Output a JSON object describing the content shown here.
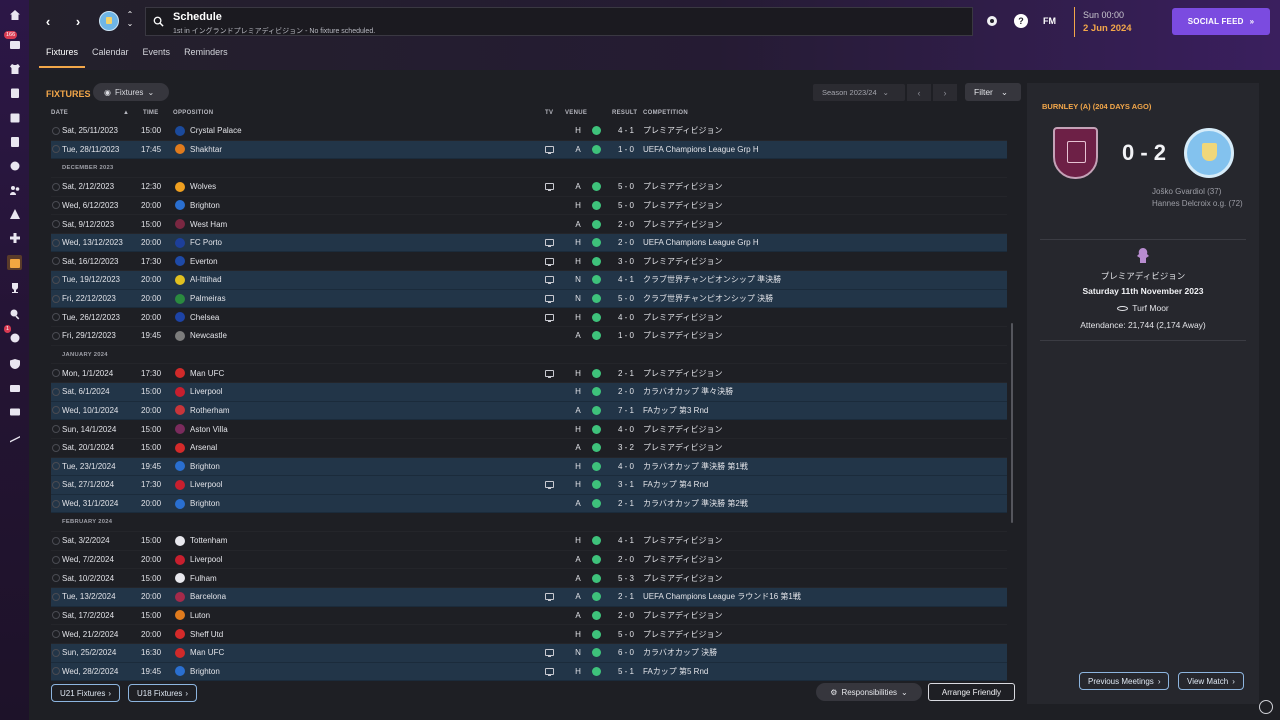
{
  "header": {
    "title": "Schedule",
    "subtitle": "1st in イングランドプレミアディビジョン - No fixture scheduled.",
    "back_glyph": "‹",
    "forward_glyph": "›",
    "fm_logo": "FM",
    "help_glyph": "?",
    "date_time": "Sun 00:00",
    "date_day": "2 Jun 2024",
    "social_feed": "SOCIAL FEED"
  },
  "tabs": [
    "Fixtures",
    "Calendar",
    "Events",
    "Reminders"
  ],
  "rail": {
    "badges": [
      "166",
      "1"
    ]
  },
  "main": {
    "section_label": "FIXTURES",
    "view_dropdown": "Fixtures",
    "season": "Season 2023/24",
    "filter": "Filter",
    "columns": {
      "date": "DATE",
      "time": "TIME",
      "opposition": "OPPOSITION",
      "tv": "TV",
      "venue": "VENUE",
      "result": "RESULT",
      "competition": "COMPETITION"
    },
    "rows": [
      {
        "date": "Sat, 25/11/2023",
        "time": "15:00",
        "opp": "Crystal Palace",
        "crest": "#1b4a9c",
        "tv": false,
        "venue": "H",
        "result": "4 - 1",
        "comp": "プレミアディビジョン",
        "hl": false
      },
      {
        "date": "Tue, 28/11/2023",
        "time": "17:45",
        "opp": "Shakhtar",
        "crest": "#e07b1d",
        "tv": true,
        "venue": "A",
        "result": "1 - 0",
        "comp": "UEFA Champions League Grp H",
        "hl": true
      },
      {
        "month": "DECEMBER 2023"
      },
      {
        "date": "Sat, 2/12/2023",
        "time": "12:30",
        "opp": "Wolves",
        "crest": "#f0a020",
        "tv": true,
        "venue": "A",
        "result": "5 - 0",
        "comp": "プレミアディビジョン",
        "hl": false
      },
      {
        "date": "Wed, 6/12/2023",
        "time": "20:00",
        "opp": "Brighton",
        "crest": "#2a6fd0",
        "tv": false,
        "venue": "H",
        "result": "5 - 0",
        "comp": "プレミアディビジョン",
        "hl": false
      },
      {
        "date": "Sat, 9/12/2023",
        "time": "15:00",
        "opp": "West Ham",
        "crest": "#7a2741",
        "tv": false,
        "venue": "A",
        "result": "2 - 0",
        "comp": "プレミアディビジョン",
        "hl": false
      },
      {
        "date": "Wed, 13/12/2023",
        "time": "20:00",
        "opp": "FC Porto",
        "crest": "#1d3f9a",
        "tv": true,
        "venue": "H",
        "result": "2 - 0",
        "comp": "UEFA Champions League Grp H",
        "hl": true
      },
      {
        "date": "Sat, 16/12/2023",
        "time": "17:30",
        "opp": "Everton",
        "crest": "#1e4aa8",
        "tv": true,
        "venue": "H",
        "result": "3 - 0",
        "comp": "プレミアディビジョン",
        "hl": false
      },
      {
        "date": "Tue, 19/12/2023",
        "time": "20:00",
        "opp": "Al-Ittihad",
        "crest": "#e0c020",
        "tv": true,
        "venue": "N",
        "result": "4 - 1",
        "comp": "クラブ世界チャンピオンシップ 準決勝",
        "hl": true
      },
      {
        "date": "Fri, 22/12/2023",
        "time": "20:00",
        "opp": "Palmeiras",
        "crest": "#2a8a3f",
        "tv": true,
        "venue": "N",
        "result": "5 - 0",
        "comp": "クラブ世界チャンピオンシップ 決勝",
        "hl": true
      },
      {
        "date": "Tue, 26/12/2023",
        "time": "20:00",
        "opp": "Chelsea",
        "crest": "#1d43a5",
        "tv": true,
        "venue": "H",
        "result": "4 - 0",
        "comp": "プレミアディビジョン",
        "hl": false
      },
      {
        "date": "Fri, 29/12/2023",
        "time": "19:45",
        "opp": "Newcastle",
        "crest": "#7c7c7c",
        "tv": false,
        "venue": "A",
        "result": "1 - 0",
        "comp": "プレミアディビジョン",
        "hl": false
      },
      {
        "month": "JANUARY 2024"
      },
      {
        "date": "Mon, 1/1/2024",
        "time": "17:30",
        "opp": "Man UFC",
        "crest": "#d02a2a",
        "tv": true,
        "venue": "H",
        "result": "2 - 1",
        "comp": "プレミアディビジョン",
        "hl": false
      },
      {
        "date": "Sat, 6/1/2024",
        "time": "15:00",
        "opp": "Liverpool",
        "crest": "#c81f2e",
        "tv": false,
        "venue": "H",
        "result": "2 - 0",
        "comp": "カラバオカップ 準々決勝",
        "hl": true
      },
      {
        "date": "Wed, 10/1/2024",
        "time": "20:00",
        "opp": "Rotherham",
        "crest": "#c8353a",
        "tv": false,
        "venue": "A",
        "result": "7 - 1",
        "comp": "FAカップ 第3 Rnd",
        "hl": true
      },
      {
        "date": "Sun, 14/1/2024",
        "time": "15:00",
        "opp": "Aston Villa",
        "crest": "#7a2b5c",
        "tv": false,
        "venue": "H",
        "result": "4 - 0",
        "comp": "プレミアディビジョン",
        "hl": false
      },
      {
        "date": "Sat, 20/1/2024",
        "time": "15:00",
        "opp": "Arsenal",
        "crest": "#d42a2a",
        "tv": false,
        "venue": "A",
        "result": "3 - 2",
        "comp": "プレミアディビジョン",
        "hl": false
      },
      {
        "date": "Tue, 23/1/2024",
        "time": "19:45",
        "opp": "Brighton",
        "crest": "#2a6fd0",
        "tv": false,
        "venue": "H",
        "result": "4 - 0",
        "comp": "カラバオカップ 準決勝 第1戦",
        "hl": true
      },
      {
        "date": "Sat, 27/1/2024",
        "time": "17:30",
        "opp": "Liverpool",
        "crest": "#c81f2e",
        "tv": true,
        "venue": "H",
        "result": "3 - 1",
        "comp": "FAカップ 第4 Rnd",
        "hl": true
      },
      {
        "date": "Wed, 31/1/2024",
        "time": "20:00",
        "opp": "Brighton",
        "crest": "#2a6fd0",
        "tv": false,
        "venue": "A",
        "result": "2 - 1",
        "comp": "カラバオカップ 準決勝 第2戦",
        "hl": true
      },
      {
        "month": "FEBRUARY 2024"
      },
      {
        "date": "Sat, 3/2/2024",
        "time": "15:00",
        "opp": "Tottenham",
        "crest": "#e8e8ee",
        "tv": false,
        "venue": "H",
        "result": "4 - 1",
        "comp": "プレミアディビジョン",
        "hl": false
      },
      {
        "date": "Wed, 7/2/2024",
        "time": "20:00",
        "opp": "Liverpool",
        "crest": "#c81f2e",
        "tv": false,
        "venue": "A",
        "result": "2 - 0",
        "comp": "プレミアディビジョン",
        "hl": false
      },
      {
        "date": "Sat, 10/2/2024",
        "time": "15:00",
        "opp": "Fulham",
        "crest": "#e8e8ee",
        "tv": false,
        "venue": "A",
        "result": "5 - 3",
        "comp": "プレミアディビジョン",
        "hl": false
      },
      {
        "date": "Tue, 13/2/2024",
        "time": "20:00",
        "opp": "Barcelona",
        "crest": "#a52a4a",
        "tv": true,
        "venue": "A",
        "result": "2 - 1",
        "comp": "UEFA Champions League ラウンド16 第1戦",
        "hl": true
      },
      {
        "date": "Sat, 17/2/2024",
        "time": "15:00",
        "opp": "Luton",
        "crest": "#e07b1d",
        "tv": false,
        "venue": "A",
        "result": "2 - 0",
        "comp": "プレミアディビジョン",
        "hl": false
      },
      {
        "date": "Wed, 21/2/2024",
        "time": "20:00",
        "opp": "Sheff Utd",
        "crest": "#d42a2a",
        "tv": false,
        "venue": "H",
        "result": "5 - 0",
        "comp": "プレミアディビジョン",
        "hl": false
      },
      {
        "date": "Sun, 25/2/2024",
        "time": "16:30",
        "opp": "Man UFC",
        "crest": "#d02a2a",
        "tv": true,
        "venue": "N",
        "result": "6 - 0",
        "comp": "カラバオカップ 決勝",
        "hl": true
      },
      {
        "date": "Wed, 28/2/2024",
        "time": "19:45",
        "opp": "Brighton",
        "crest": "#2a6fd0",
        "tv": true,
        "venue": "H",
        "result": "5 - 1",
        "comp": "FAカップ 第5 Rnd",
        "hl": true
      }
    ],
    "u21_button": "U21 Fixtures",
    "u18_button": "U18 Fixtures",
    "responsibilities": "Responsibilities",
    "arrange_friendly": "Arrange Friendly"
  },
  "side": {
    "heading": "BURNLEY (A) (204 DAYS AGO)",
    "score": "0 - 2",
    "scorer_1": "Joško Gvardiol (37)",
    "scorer_2": "Hannes Delcroix o.g. (72)",
    "competition": "プレミアディビジョン",
    "match_date": "Saturday 11th November 2023",
    "stadium": "Turf Moor",
    "attendance": "Attendance: 21,744 (2,174 Away)",
    "prev_meetings": "Previous Meetings",
    "view_match": "View Match"
  },
  "colors": {
    "accent": "#f3a74a",
    "social": "#7b4be0",
    "win_dot": "#3ec27b",
    "highlight_row": "#223548"
  }
}
